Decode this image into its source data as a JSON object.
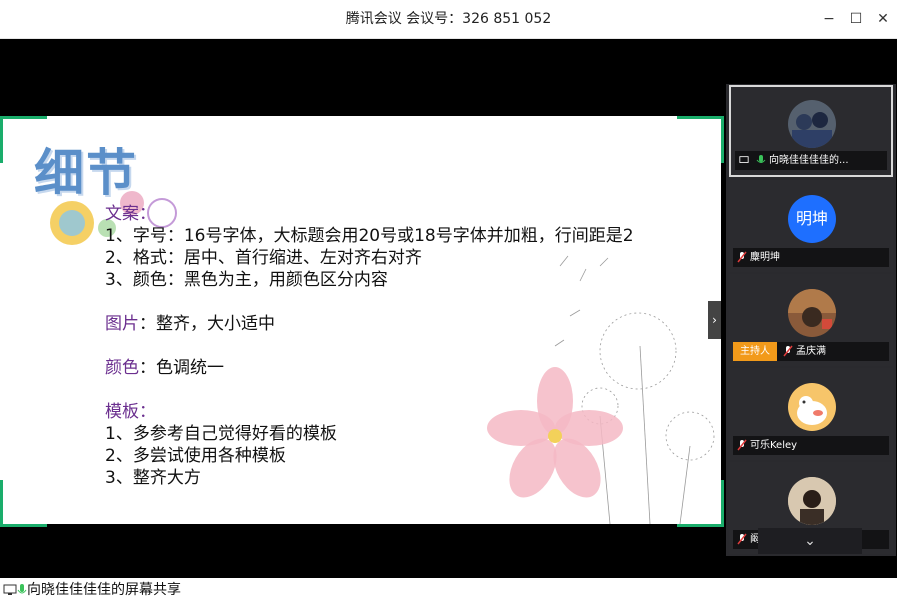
{
  "window": {
    "title": "腾讯会议 会议号：326 851 052",
    "controls": {
      "minimize": "−",
      "maximize": "☐",
      "close": "✕"
    }
  },
  "slide": {
    "title": "细节",
    "sections": {
      "wenan": {
        "heading": "文案",
        "colon": "："
      },
      "wenan_lines": [
        "1、字号：16号字体，大标题会用20号或18号字体并加粗，行间距是2",
        "2、格式：居中、首行缩进、左对齐右对齐",
        "3、颜色：黑色为主，用颜色区分内容"
      ],
      "tupian": {
        "heading": "图片",
        "text": "：整齐，大小适中"
      },
      "yanse": {
        "heading": "颜色",
        "text": "：色调统一"
      },
      "moban": {
        "heading": "模板",
        "colon": "："
      },
      "moban_lines": [
        "1、多参考自己觉得好看的模板",
        "2、多尝试使用各种模板",
        "3、整齐大方"
      ]
    },
    "colors": {
      "heading": "#6b2f8f",
      "title": "#5b8fc9",
      "frame": "#1aad6b"
    }
  },
  "participants": [
    {
      "name": "向晓佳佳佳佳的...",
      "avatar_icon": "photo-avatar",
      "active": true
    },
    {
      "name": "麋明坤",
      "avatar_text": "明坤",
      "avatar_color": "#1e6fff"
    },
    {
      "name": "孟庆满",
      "avatar_icon": "photo-avatar",
      "host_badge": "主持人"
    },
    {
      "name": "可乐Keley",
      "avatar_icon": "cartoon-avatar"
    },
    {
      "name": "阚蕊",
      "avatar_icon": "photo-avatar"
    }
  ],
  "panel": {
    "expand_arrow": "›",
    "scroll_down": "⌄"
  },
  "share_status": "向晓佳佳佳佳的屏幕共享"
}
